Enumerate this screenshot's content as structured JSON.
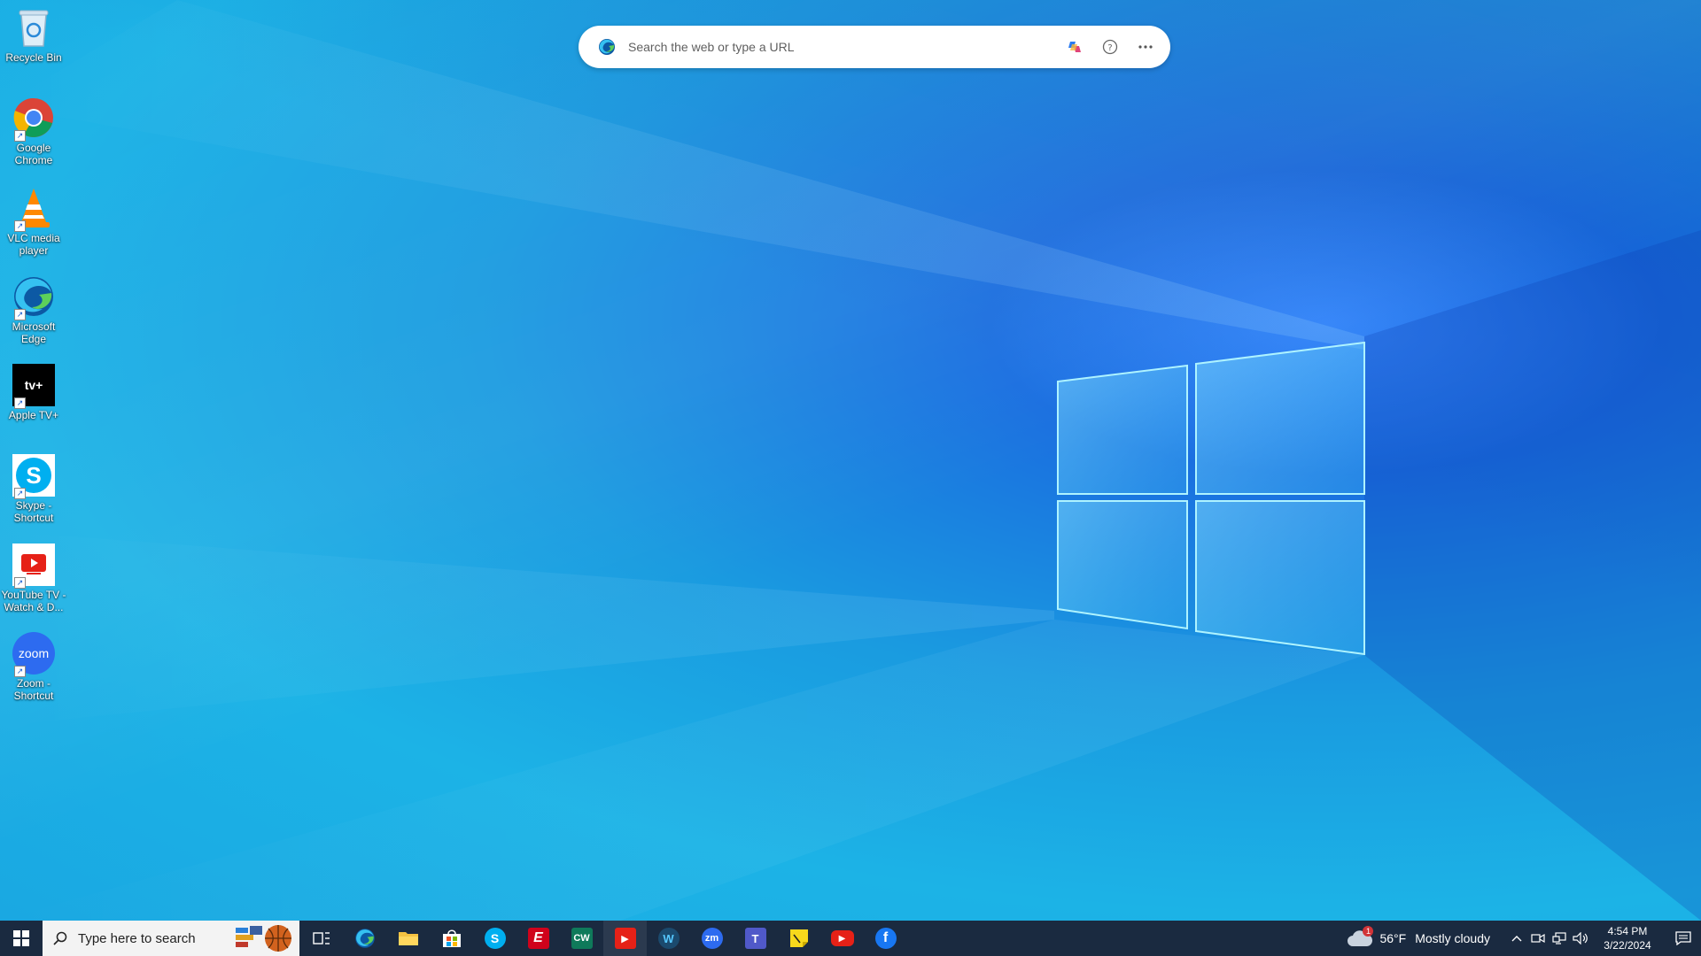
{
  "desktop_icons": [
    {
      "id": "recycle-bin",
      "label": "Recycle Bin"
    },
    {
      "id": "google-chrome",
      "label": "Google Chrome"
    },
    {
      "id": "vlc",
      "label": "VLC media player"
    },
    {
      "id": "edge",
      "label": "Microsoft Edge"
    },
    {
      "id": "apple-tv",
      "label": "Apple TV+",
      "glyph": "tv+"
    },
    {
      "id": "skype",
      "label": "Skype - Shortcut",
      "glyph": "S"
    },
    {
      "id": "youtube-tv",
      "label": "YouTube TV - Watch & D..."
    },
    {
      "id": "zoom",
      "label": "Zoom - Shortcut",
      "glyph": "zoom"
    }
  ],
  "edge_search": {
    "placeholder": "Search the web or type a URL"
  },
  "taskbar": {
    "search_placeholder": "Type here to search",
    "apps": [
      {
        "name": "task-view",
        "glyph": ""
      },
      {
        "name": "edge",
        "glyph": ""
      },
      {
        "name": "file-explorer",
        "glyph": ""
      },
      {
        "name": "microsoft-store",
        "glyph": ""
      },
      {
        "name": "skype",
        "glyph": "S"
      },
      {
        "name": "espn",
        "glyph": "E"
      },
      {
        "name": "cw",
        "glyph": "CW"
      },
      {
        "name": "youtube-tv",
        "glyph": "▶"
      },
      {
        "name": "webex",
        "glyph": "W"
      },
      {
        "name": "zoom",
        "glyph": "zm"
      },
      {
        "name": "teams",
        "glyph": "T"
      },
      {
        "name": "sticky-notes",
        "glyph": ""
      },
      {
        "name": "youtube",
        "glyph": "▶"
      },
      {
        "name": "facebook",
        "glyph": "f"
      }
    ]
  },
  "tray": {
    "weather_temp": "56°F",
    "weather_condition": "Mostly cloudy",
    "weather_badge": "1",
    "time": "4:54 PM",
    "date": "3/22/2024"
  },
  "colors": {
    "taskbar_bg": "#1a2a40",
    "accent": "#0078d4"
  }
}
